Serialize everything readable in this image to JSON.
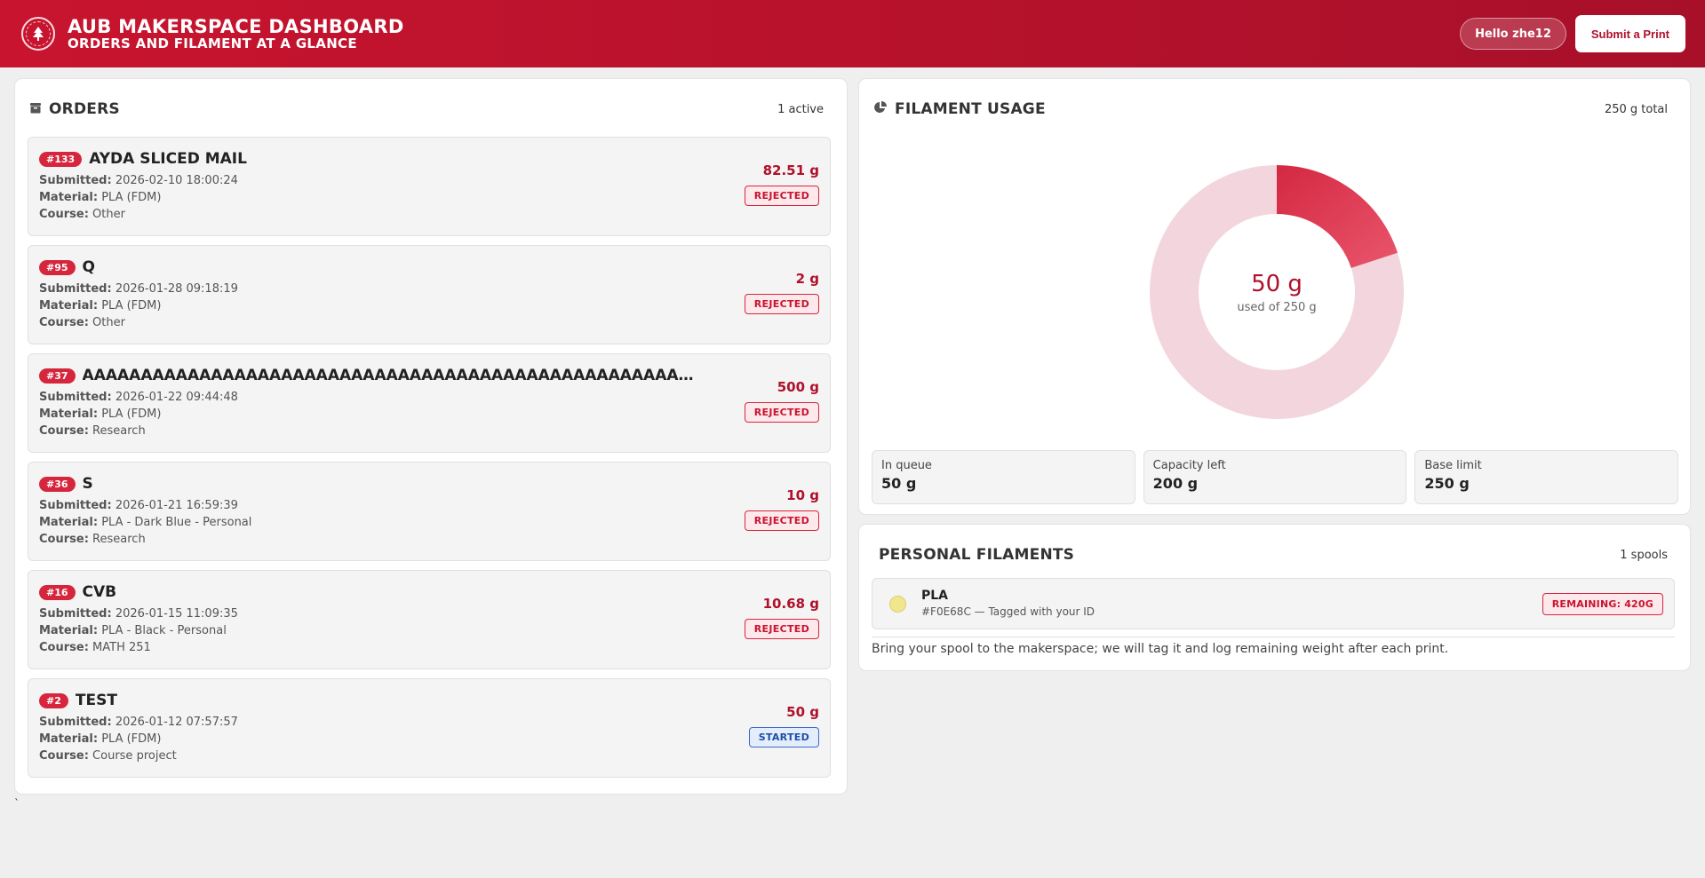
{
  "header": {
    "title": "AUB MAKERSPACE DASHBOARD",
    "subtitle": "ORDERS AND FILAMENT AT A GLANCE",
    "greeting": "Hello zhe12",
    "submit_label": "Submit a Print"
  },
  "orders": {
    "title": "ORDERS",
    "meta": "1 active",
    "field_labels": {
      "submitted": "Submitted:",
      "material": "Material:",
      "course": "Course:"
    },
    "items": [
      {
        "id": "#133",
        "name": "AYDA SLICED MAIL",
        "submitted": "2026-02-10 18:00:24",
        "material": "PLA (FDM)",
        "course": "Other",
        "weight": "82.51 g",
        "status": "REJECTED",
        "status_type": "rejected"
      },
      {
        "id": "#95",
        "name": "Q",
        "submitted": "2026-01-28 09:18:19",
        "material": "PLA (FDM)",
        "course": "Other",
        "weight": "2 g",
        "status": "REJECTED",
        "status_type": "rejected"
      },
      {
        "id": "#37",
        "name": "AAAAAAAAAAAAAAAAAAAAAAAAAAAAAAAAAAAAAAAAAAAAAAAAAAAA...",
        "submitted": "2026-01-22 09:44:48",
        "material": "PLA (FDM)",
        "course": "Research",
        "weight": "500 g",
        "status": "REJECTED",
        "status_type": "rejected"
      },
      {
        "id": "#36",
        "name": "S",
        "submitted": "2026-01-21 16:59:39",
        "material": "PLA - Dark Blue - Personal",
        "course": "Research",
        "weight": "10 g",
        "status": "REJECTED",
        "status_type": "rejected"
      },
      {
        "id": "#16",
        "name": "CVB",
        "submitted": "2026-01-15 11:09:35",
        "material": "PLA - Black - Personal",
        "course": "MATH 251",
        "weight": "10.68 g",
        "status": "REJECTED",
        "status_type": "rejected"
      },
      {
        "id": "#2",
        "name": "TEST",
        "submitted": "2026-01-12 07:57:57",
        "material": "PLA (FDM)",
        "course": "Course project",
        "weight": "50 g",
        "status": "STARTED",
        "status_type": "started"
      }
    ],
    "stray_text": "`"
  },
  "usage": {
    "title": "FILAMENT USAGE",
    "meta": "250 g total",
    "center_value": "50 g",
    "center_label": "used of 250 g",
    "used_fraction": 0.2,
    "colors": {
      "used_start": "#d42842",
      "used_end": "#e9566c",
      "remaining": "#f3d6dd"
    },
    "stats": [
      {
        "label": "In queue",
        "value": "50 g"
      },
      {
        "label": "Capacity left",
        "value": "200 g"
      },
      {
        "label": "Base limit",
        "value": "250 g"
      }
    ]
  },
  "personal": {
    "title": "PERSONAL FILAMENTS",
    "meta": "1 spools",
    "spools": [
      {
        "name": "PLA",
        "meta": "#F0E68C — Tagged with your ID",
        "color": "#F0E68C",
        "remaining": "REMAINING: 420G"
      }
    ],
    "note": "Bring your spool to the makerspace; we will tag it and log remaining weight after each print."
  }
}
